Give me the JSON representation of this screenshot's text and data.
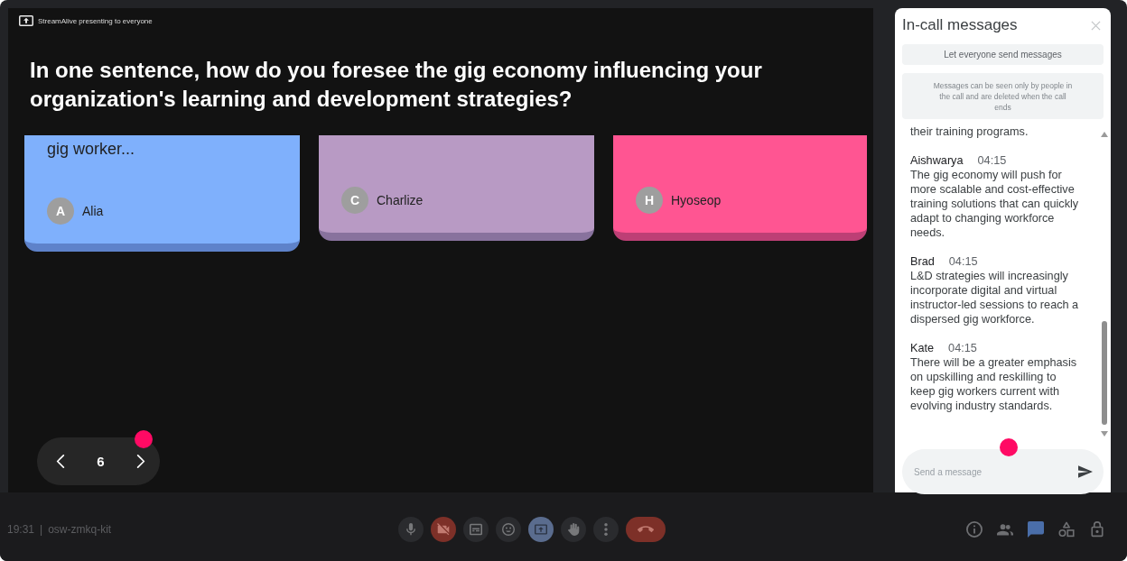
{
  "presenting_banner": {
    "text": "StreamAlive presenting to everyone"
  },
  "slide": {
    "question": "In one sentence, how do you foresee the gig economy influencing your organization's learning and development strategies?",
    "cards": [
      {
        "text": "gig worker...",
        "initial": "A",
        "author": "Alia",
        "color": "#7fb0fc"
      },
      {
        "initial": "C",
        "author": "Charlize",
        "color": "#b89ac4"
      },
      {
        "initial": "H",
        "author": "Hyoseop",
        "color": "#ff5592"
      }
    ]
  },
  "slide_nav": {
    "page": "6"
  },
  "chat_panel": {
    "title": "In-call messages",
    "toggle_button": "Let everyone send messages",
    "notice": "Messages can be seen only by people in the call and are deleted when the call ends",
    "messages": [
      {
        "kind": "continuation",
        "text": "their training programs."
      },
      {
        "kind": "message",
        "sender": "Aishwarya",
        "time": "04:15",
        "text": "The gig economy will push for more scalable and cost-effective training solutions that can quickly adapt to changing workforce needs."
      },
      {
        "kind": "message",
        "sender": "Brad",
        "time": "04:15",
        "text": "L&D strategies will increasingly incorporate digital and virtual instructor-led sessions to reach a dispersed gig workforce."
      },
      {
        "kind": "message",
        "sender": "Kate",
        "time": "04:15",
        "text": "There will be a greater emphasis on upskilling and reskilling to keep gig workers current with evolving industry standards."
      }
    ],
    "input": {
      "placeholder": "Send a message"
    }
  },
  "meeting_info": {
    "time": "19:31",
    "separator": "|",
    "code": "osw-zmkq-kit"
  },
  "call_controls": [
    {
      "kind": "mic",
      "on": true
    },
    {
      "kind": "camera",
      "on": false
    },
    {
      "kind": "captions",
      "on": false
    },
    {
      "kind": "reactions"
    },
    {
      "kind": "present",
      "on": true
    },
    {
      "kind": "raise-hand",
      "on": false
    },
    {
      "kind": "more"
    },
    {
      "kind": "leave"
    }
  ],
  "panel_buttons": [
    {
      "kind": "info",
      "selected": false
    },
    {
      "kind": "people",
      "selected": false
    },
    {
      "kind": "chat",
      "selected": true
    },
    {
      "kind": "activities",
      "selected": false
    },
    {
      "kind": "host-controls",
      "selected": false
    }
  ]
}
